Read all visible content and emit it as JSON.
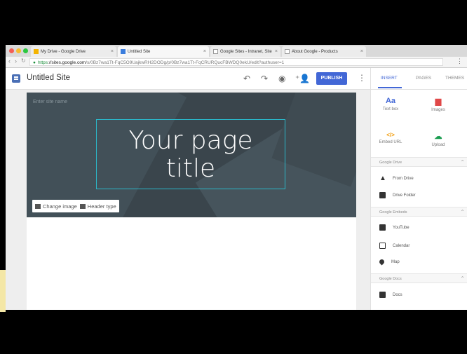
{
  "browser": {
    "tabs": [
      {
        "label": "My Drive - Google Drive"
      },
      {
        "label": "Untitled Site"
      },
      {
        "label": "Google Sites - Intranet, Site"
      },
      {
        "label": "About Google - Products"
      }
    ],
    "url_scheme": "https",
    "url_domain": "://sites.google.com",
    "url_path": "/s/0Bz7wa1Tt-FqC5O9UajkwRH2DODg/p/0Bz7wa1Tt-FqCRURQucFBWDQ0ekU/edit?authuser=1"
  },
  "header": {
    "site_title": "Untitled Site",
    "publish_label": "PUBLISH"
  },
  "hero": {
    "site_name_placeholder": "Enter site name",
    "page_title_line1": "Your page",
    "page_title_line2": "title",
    "change_image_label": "Change image",
    "header_type_label": "Header type"
  },
  "panel": {
    "tabs": {
      "insert": "INSERT",
      "pages": "PAGES",
      "themes": "THEMES"
    },
    "tools": {
      "text_box": {
        "icon": "Aa",
        "label": "Text box"
      },
      "images": {
        "label": "Images"
      },
      "embed_url": {
        "icon": "</>",
        "label": "Embed URL"
      },
      "upload": {
        "label": "Upload"
      }
    },
    "sections": {
      "drive": "Google Drive",
      "embeds": "Google Embeds",
      "docs": "Google Docs"
    },
    "items": {
      "from_drive": "From Drive",
      "drive_folder": "Drive Folder",
      "youtube": "YouTube",
      "calendar": "Calendar",
      "map": "Map",
      "docs": "Docs"
    }
  },
  "colors": {
    "accent": "#4267d6",
    "hero_bg": "#3a454c",
    "title_outline": "#2bb7c9"
  }
}
